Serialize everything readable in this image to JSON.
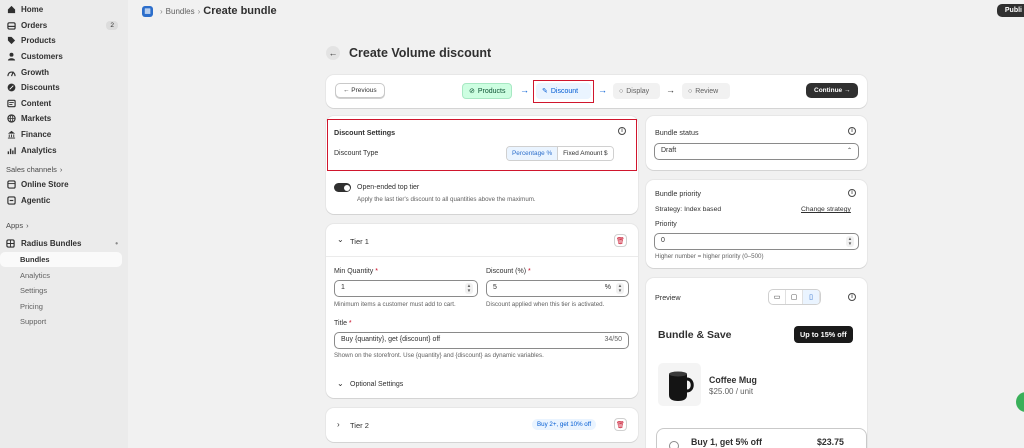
{
  "sidebar": {
    "items": [
      {
        "label": "Home",
        "icon": "home-icon"
      },
      {
        "label": "Orders",
        "icon": "orders-icon",
        "badge": "2"
      },
      {
        "label": "Products",
        "icon": "tag-icon"
      },
      {
        "label": "Customers",
        "icon": "person-icon"
      },
      {
        "label": "Growth",
        "icon": "growth-icon"
      },
      {
        "label": "Discounts",
        "icon": "discount-icon"
      },
      {
        "label": "Content",
        "icon": "content-icon"
      },
      {
        "label": "Markets",
        "icon": "globe-icon"
      },
      {
        "label": "Finance",
        "icon": "bank-icon"
      },
      {
        "label": "Analytics",
        "icon": "chart-icon"
      }
    ],
    "sales_channels_title": "Sales channels",
    "channels": [
      {
        "label": "Online Store",
        "icon": "store-icon"
      },
      {
        "label": "Agentic",
        "icon": "agent-icon"
      }
    ],
    "apps_title": "Apps",
    "app_name": "Radius Bundles",
    "app_subitems": [
      "Bundles",
      "Analytics",
      "Settings",
      "Pricing",
      "Support"
    ]
  },
  "topbar": {
    "crumb": "Bundles",
    "current": "Create bundle",
    "publish": "Publi"
  },
  "page": {
    "title": "Create Volume discount"
  },
  "stepper": {
    "previous": "← Previous",
    "steps": [
      "Products",
      "Discount",
      "Display",
      "Review"
    ],
    "continue": "Continue →"
  },
  "discount_settings": {
    "title": "Discount Settings",
    "type_label": "Discount Type",
    "options": [
      "Percentage %",
      "Fixed Amount $"
    ],
    "selected": "Percentage %"
  },
  "open_ended": {
    "label": "Open-ended top tier",
    "help": "Apply the last tier's discount to all quantities above the maximum.",
    "enabled": true
  },
  "tier1": {
    "title": "Tier 1",
    "min_qty_label": "Min Quantity",
    "min_qty_value": "1",
    "min_qty_help": "Minimum items a customer must add to cart.",
    "discount_label": "Discount (%)",
    "discount_value": "5",
    "discount_suffix": "%",
    "discount_help": "Discount applied when this tier is activated.",
    "title_label": "Title",
    "title_value": "Buy {quantity}, get {discount} off",
    "title_count": "34/50",
    "title_help": "Shown on the storefront. Use {quantity} and {discount} as dynamic variables.",
    "optional": "Optional Settings"
  },
  "tier2": {
    "title": "Tier 2",
    "badge": "Buy 2+, get 10% off"
  },
  "bundle_status": {
    "title": "Bundle status",
    "value": "Draft"
  },
  "bundle_priority": {
    "title": "Bundle priority",
    "strategy": "Strategy: Index based",
    "change": "Change strategy",
    "priority_label": "Priority",
    "priority_value": "0",
    "help": "Higher number = higher priority (0–500)"
  },
  "preview": {
    "title": "Preview",
    "bundle_title": "Bundle & Save",
    "badge": "Up to 15% off",
    "product_name": "Coffee Mug",
    "product_price": "$25.00 / unit",
    "offer_label": "Buy 1, get 5% off",
    "offer_price": "$23.75"
  },
  "colors": {
    "accent": "#005bd3",
    "done": "#cdfee1",
    "highlight": "#d0162d",
    "dark": "#303030"
  }
}
